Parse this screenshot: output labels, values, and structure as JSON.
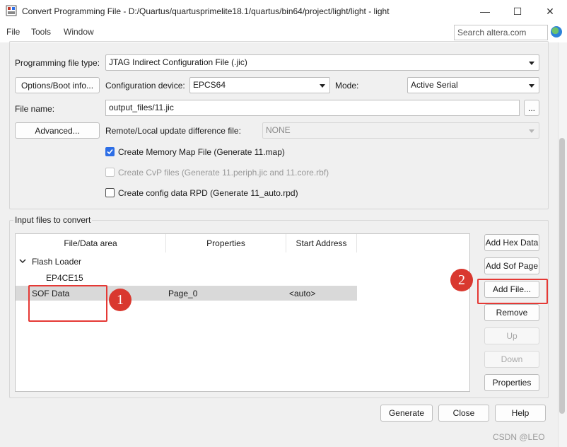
{
  "window": {
    "title": "Convert Programming File - D:/Quartus/quartusprimelite18.1/quartus/bin64/project/light/light - light",
    "minimize": "—",
    "maximize": "☐",
    "close": "✕"
  },
  "menu": {
    "items": [
      "File",
      "Tools",
      "Window"
    ],
    "search_placeholder": "Search altera.com"
  },
  "output": {
    "file_type_label": "Programming file type:",
    "file_type_value": "JTAG Indirect Configuration File (.jic)",
    "options_button": "Options/Boot info...",
    "config_device_label": "Configuration device:",
    "config_device_value": "EPCS64",
    "mode_label": "Mode:",
    "mode_value": "Active Serial",
    "file_name_label": "File name:",
    "file_name_value": "output_files/11.jic",
    "browse_button": "...",
    "advanced_button": "Advanced...",
    "remote_label": "Remote/Local update difference file:",
    "remote_value": "NONE",
    "chk_memory_map": "Create Memory Map File (Generate 11.map)",
    "chk_memory_map_checked": true,
    "chk_cvp": "Create CvP files (Generate 11.periph.jic and 11.core.rbf)",
    "chk_cvp_checked": false,
    "chk_rpd": "Create config data RPD (Generate 11_auto.rpd)",
    "chk_rpd_checked": false
  },
  "input": {
    "group_label": "Input files to convert",
    "columns": [
      "File/Data area",
      "Properties",
      "Start Address"
    ],
    "tree": {
      "root": "Flash Loader",
      "device": "EP4CE15",
      "sof_row": {
        "name": "SOF Data",
        "properties": "Page_0",
        "start_address": "<auto>"
      }
    },
    "side_buttons": {
      "add_hex": "Add Hex Data",
      "add_sof_page": "Add Sof Page",
      "add_file": "Add File...",
      "remove": "Remove",
      "up": "Up",
      "down": "Down",
      "properties": "Properties"
    }
  },
  "bottom": {
    "generate": "Generate",
    "close": "Close",
    "help": "Help"
  },
  "annotations": {
    "badge1": "1",
    "badge2": "2",
    "highlight_color": "#e53935"
  },
  "watermark": "CSDN @LEO"
}
